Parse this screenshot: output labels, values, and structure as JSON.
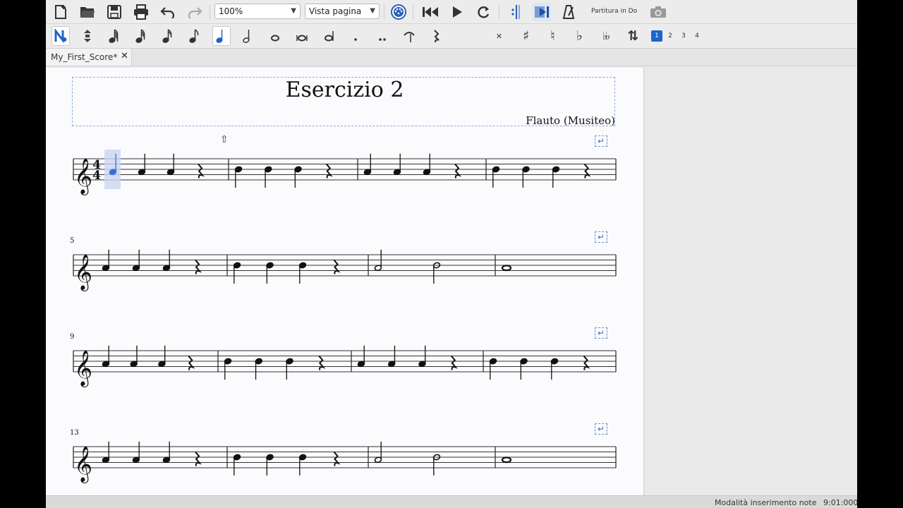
{
  "toolbar": {
    "zoom": "100%",
    "view_mode": "Vista pagina",
    "concert_pitch_label": "Partitura in Do"
  },
  "note_toolbar": {
    "durations": [
      "1/64",
      "1/32",
      "1/16",
      "1/8",
      "quarter",
      "half",
      "whole",
      "breve",
      "longa",
      "dot",
      "double-dot",
      "tie",
      "rest"
    ],
    "accidentals": [
      "double-sharp",
      "sharp",
      "natural",
      "flat",
      "double-flat",
      "flip"
    ],
    "voices": [
      "1",
      "2",
      "3",
      "4"
    ],
    "active_duration": "quarter",
    "active_voice": "1"
  },
  "tab": {
    "title": "My_First_Score*",
    "close": "✕"
  },
  "score": {
    "title": "Esercizio 2",
    "composer": "Flauto (Musiteo)",
    "time_signature": "4/4",
    "systems": [
      {
        "first_measure": "",
        "measures": [
          [
            "A4/4",
            "A4/4",
            "A4/4",
            "rest/4"
          ],
          [
            "B4/4",
            "B4/4",
            "B4/4",
            "rest/4"
          ],
          [
            "A4/4",
            "A4/4",
            "A4/4",
            "rest/4"
          ],
          [
            "B4/4",
            "B4/4",
            "B4/4",
            "rest/4"
          ]
        ]
      },
      {
        "first_measure": "5",
        "measures": [
          [
            "A4/4",
            "A4/4",
            "A4/4",
            "rest/4"
          ],
          [
            "B4/4",
            "B4/4",
            "B4/4",
            "rest/4"
          ],
          [
            "A4/2",
            "B4/2"
          ],
          [
            "A4/1"
          ]
        ]
      },
      {
        "first_measure": "9",
        "measures": [
          [
            "A4/4",
            "A4/4",
            "A4/4",
            "rest/4"
          ],
          [
            "B4/4",
            "B4/4",
            "B4/4",
            "rest/4"
          ],
          [
            "A4/4",
            "A4/4",
            "A4/4",
            "rest/4"
          ],
          [
            "B4/4",
            "B4/4",
            "B4/4",
            "rest/4"
          ]
        ]
      },
      {
        "first_measure": "13",
        "measures": [
          [
            "A4/4",
            "A4/4",
            "A4/4",
            "rest/4"
          ],
          [
            "B4/4",
            "B4/4",
            "B4/4",
            "rest/4"
          ],
          [
            "A4/2",
            "B4/2"
          ],
          [
            "A4/1"
          ]
        ]
      }
    ],
    "selected_note": "measure 1, beat 1"
  },
  "status": {
    "mode": "Modalità inserimento note",
    "position": "9:01:000"
  },
  "colors": {
    "selection": "#3a6fd6",
    "accent": "#1f64c9",
    "page": "#fbfbfe"
  }
}
